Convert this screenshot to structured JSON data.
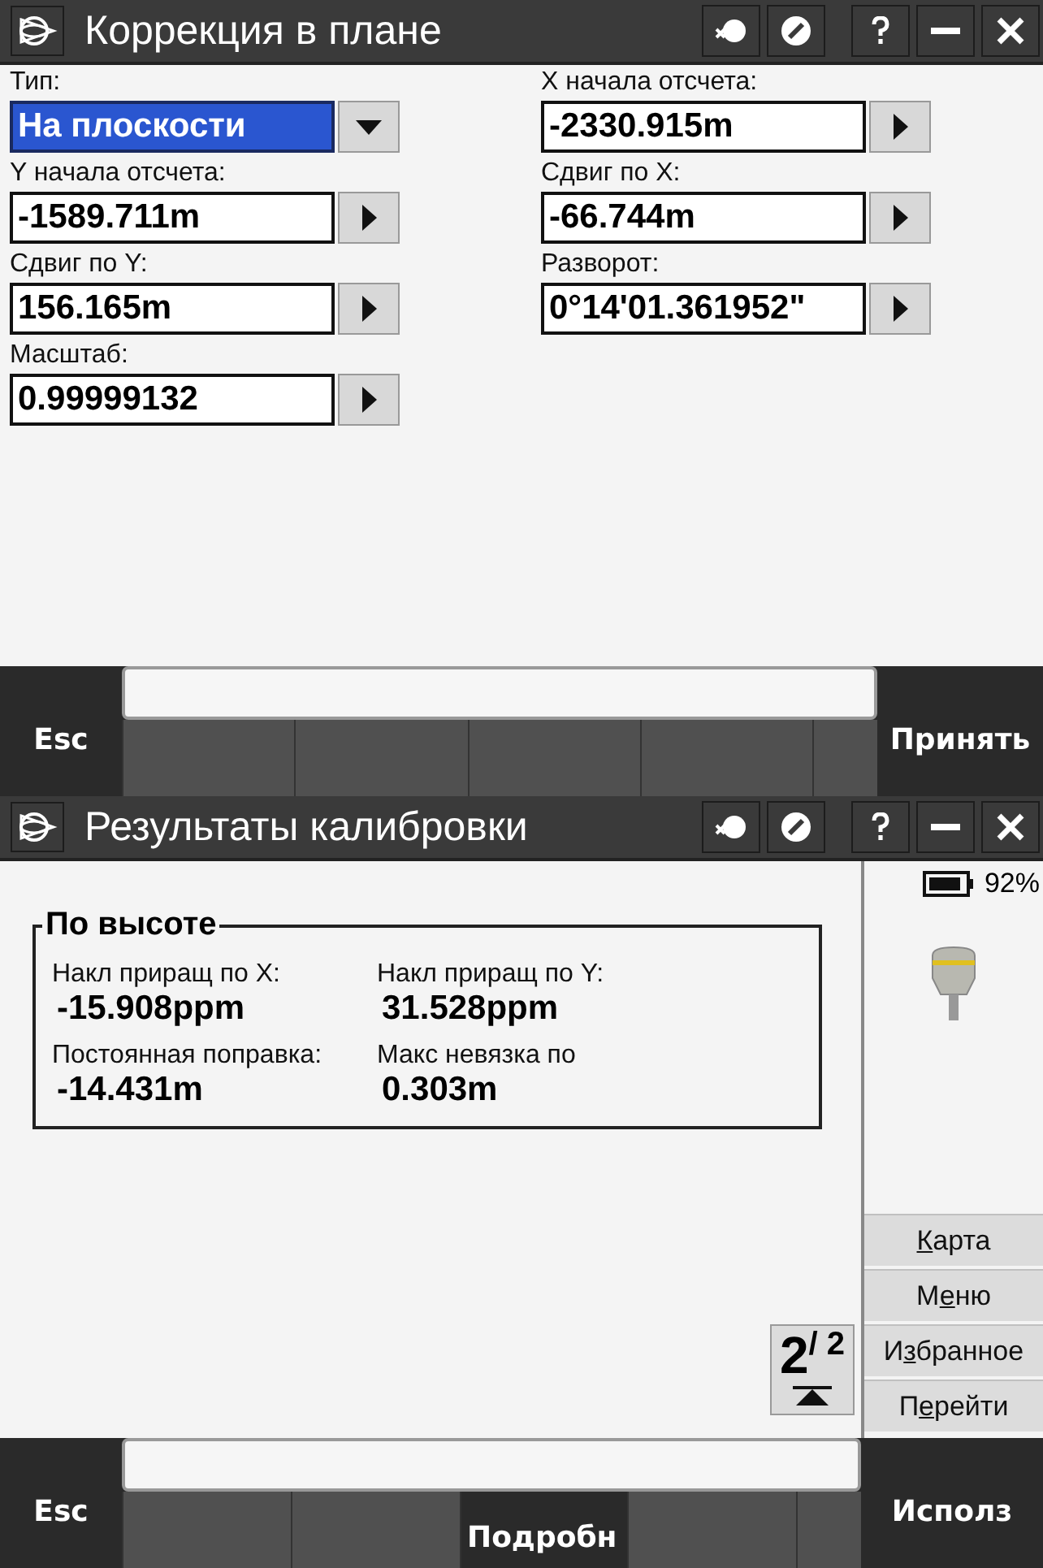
{
  "windows": [
    {
      "title": "Коррекция в плане",
      "kind": "form",
      "fields": [
        {
          "label": "Тип:",
          "kind": "dropdown",
          "value": "На плоскости",
          "selected": true
        },
        {
          "label": "X начала отсчета:",
          "kind": "entry",
          "value": "-2330.915m"
        },
        {
          "label": "Y начала отсчета:",
          "kind": "entry",
          "value": "-1589.711m"
        },
        {
          "label": "Сдвиг по X:",
          "kind": "entry",
          "value": "-66.744m"
        },
        {
          "label": "Сдвиг по Y:",
          "kind": "entry",
          "value": "156.165m"
        },
        {
          "label": "Разворот:",
          "kind": "entry",
          "value": "0°14'01.361952\""
        },
        {
          "label": "Масштаб:",
          "kind": "entry",
          "value": "0.99999132"
        }
      ],
      "left_key": "Esc",
      "right_key": "Принять",
      "softkeys": [
        {
          "selected": false
        },
        {
          "selected": false
        },
        {
          "selected": false
        },
        {
          "selected": false
        },
        {
          "selected": false
        }
      ]
    },
    {
      "title": "Результаты калибровки",
      "kind": "results",
      "battery": "92%",
      "group": {
        "title": "По высоте",
        "items": [
          {
            "label": "Накл приращ по X:",
            "value": "-15.908ppm"
          },
          {
            "label": "Накл приращ по Y:",
            "value": "31.528ppm"
          },
          {
            "label": "Постоянная поправка:",
            "value": "-14.431m"
          },
          {
            "label": "Макс невязка по",
            "value": "0.303m"
          }
        ]
      },
      "page_button": "2$^{/ 2}$",
      "side_buttons": [
        {
          "label": [
            {
              "text": "К",
              "underline": true
            },
            {
              "text": "арта",
              "underline": false
            }
          ]
        },
        {
          "label": [
            {
              "text": "М",
              "underline": false
            },
            {
              "text": "е",
              "underline": true
            },
            {
              "text": "ню",
              "underline": false
            }
          ]
        },
        {
          "label": [
            {
              "text": "И",
              "underline": false
            },
            {
              "text": "з",
              "underline": true
            },
            {
              "text": "бранное",
              "underline": false
            }
          ]
        },
        {
          "label": [
            {
              "text": "П",
              "underline": false
            },
            {
              "text": "е",
              "underline": true
            },
            {
              "text": "рейти",
              "underline": false
            }
          ]
        }
      ],
      "left_key": "Esc",
      "right_key": "Исполз",
      "softkeys": [
        {
          "selected": false
        },
        {
          "selected": false
        },
        {
          "selected": true,
          "label": "Подробн"
        },
        {
          "selected": false
        },
        {
          "selected": false
        }
      ]
    }
  ]
}
